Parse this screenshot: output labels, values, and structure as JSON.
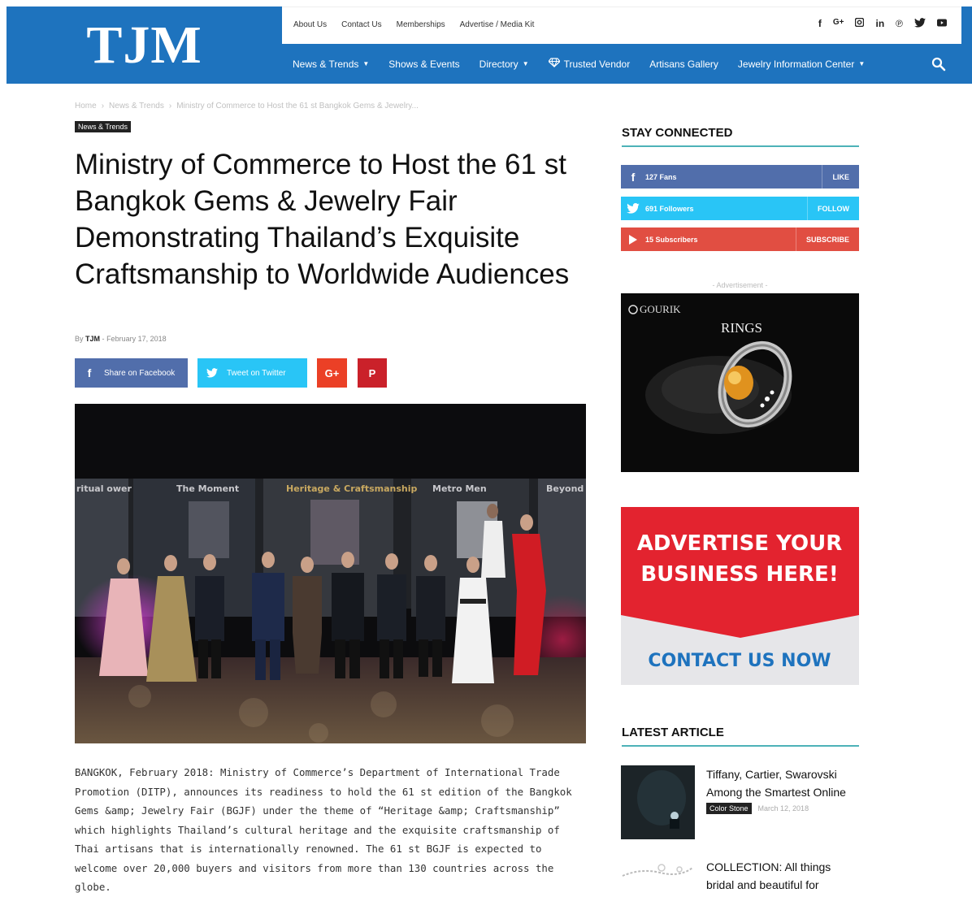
{
  "header": {
    "logo": "TJM",
    "top_links": [
      "About Us",
      "Contact Us",
      "Memberships",
      "Advertise / Media Kit"
    ],
    "social_icons": [
      "facebook-icon",
      "google-plus-icon",
      "instagram-icon",
      "linkedin-icon",
      "pinterest-icon",
      "twitter-icon",
      "youtube-icon"
    ],
    "nav": [
      {
        "label": "News & Trends",
        "dropdown": true
      },
      {
        "label": "Shows & Events",
        "dropdown": false
      },
      {
        "label": "Directory",
        "dropdown": true
      },
      {
        "label": "Trusted Vendor",
        "dropdown": false,
        "icon": "diamond-icon"
      },
      {
        "label": "Artisans Gallery",
        "dropdown": false
      },
      {
        "label": "Jewelry Information Center",
        "dropdown": true
      }
    ]
  },
  "breadcrumb": [
    "Home",
    "News & Trends",
    "Ministry of Commerce to Host the 61 st Bangkok Gems & Jewelry..."
  ],
  "article": {
    "category": "News & Trends",
    "title": "Ministry of Commerce to Host the 61 st Bangkok Gems & Jewelry Fair Demonstrating Thailand’s Exquisite Craftsmanship to Worldwide Audiences",
    "by_label": "By",
    "author": "TJM",
    "separator": "-",
    "date": "February 17, 2018",
    "share": {
      "facebook": "Share on Facebook",
      "twitter": "Tweet on Twitter"
    },
    "body": "BANGKOK, February 2018: Ministry of Commerce’s Department of International Trade Promotion (DITP), announces its readiness to hold the 61 st edition of the Bangkok Gems &amp; Jewelry Fair (BGJF) under the theme of “Heritage &amp; Craftsmanship” which highlights Thailand’s cultural heritage and the exquisite craftsmanship of Thai artisans that is internationally renowned. The 61 st BGJF is expected to welcome over 20,000 buyers and visitors from more than 130 countries across the globe.",
    "hero_booths": [
      "ritual ower",
      "The Moment",
      "Heritage & Craftsmanship",
      "Metro Men",
      "Beyond"
    ]
  },
  "sidebar": {
    "stay_connected": "STAY CONNECTED",
    "social": [
      {
        "icon": "facebook-icon",
        "count": "127",
        "unit": "Fans",
        "action": "LIKE",
        "color": "#516eab"
      },
      {
        "icon": "twitter-icon",
        "count": "691",
        "unit": "Followers",
        "action": "FOLLOW",
        "color": "#29c5f6"
      },
      {
        "icon": "youtube-icon",
        "count": "15",
        "unit": "Subscribers",
        "action": "SUBSCRIBE",
        "color": "#e14e42"
      }
    ],
    "ad_label": "- Advertisement -",
    "ad1": {
      "brand": "GOURIK",
      "caption": "RINGS"
    },
    "ad2": {
      "headline_1": "ADVERTISE YOUR",
      "headline_2": "BUSINESS HERE!",
      "cta": "CONTACT US NOW"
    },
    "latest_title": "LATEST ARTICLE",
    "latest": [
      {
        "title": "Tiffany, Cartier, Swarovski Among the Smartest Online",
        "category": "Color Stone",
        "date": "March 12, 2018"
      },
      {
        "title": "COLLECTION: All things bridal and beautiful for",
        "category": "",
        "date": ""
      }
    ]
  },
  "colors": {
    "brand_blue": "#1e73be",
    "accent_teal": "#4db2b8",
    "ad_red": "#e3232f",
    "ad_cta_blue": "#1e73be"
  }
}
